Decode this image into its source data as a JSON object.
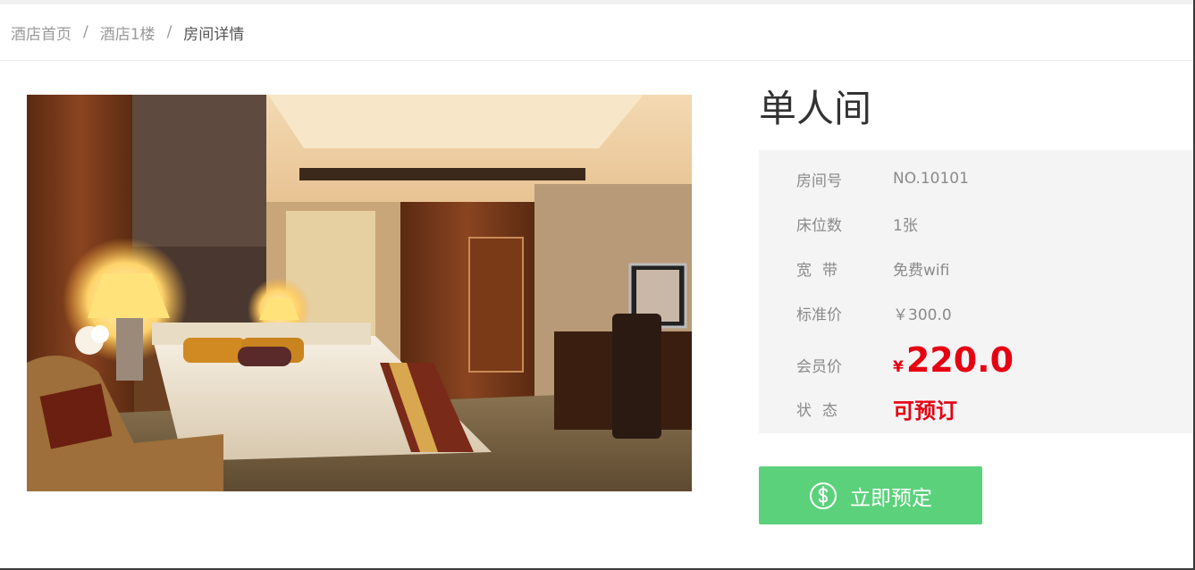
{
  "breadcrumb": {
    "items": [
      "酒店首页",
      "酒店1楼"
    ],
    "separator": "/",
    "current": "房间详情"
  },
  "room": {
    "title": "单人间",
    "fields": {
      "room_no": {
        "label": "房间号",
        "value": "NO.10101"
      },
      "beds": {
        "label": "床位数",
        "value": "1张"
      },
      "broadband": {
        "label": "宽带",
        "value": "免费wifi"
      },
      "standard_price": {
        "label": "标准价",
        "value": "￥300.0"
      },
      "member_price": {
        "label": "会员价",
        "currency": "¥",
        "value": "220.0"
      },
      "status": {
        "label": "状态",
        "value": "可预订"
      }
    }
  },
  "actions": {
    "book_label": "立即预定",
    "book_icon": "dollar-circle-icon"
  },
  "colors": {
    "accent_green": "#5cd17b",
    "price_red": "#e60012",
    "panel_bg": "#f4f4f4"
  }
}
